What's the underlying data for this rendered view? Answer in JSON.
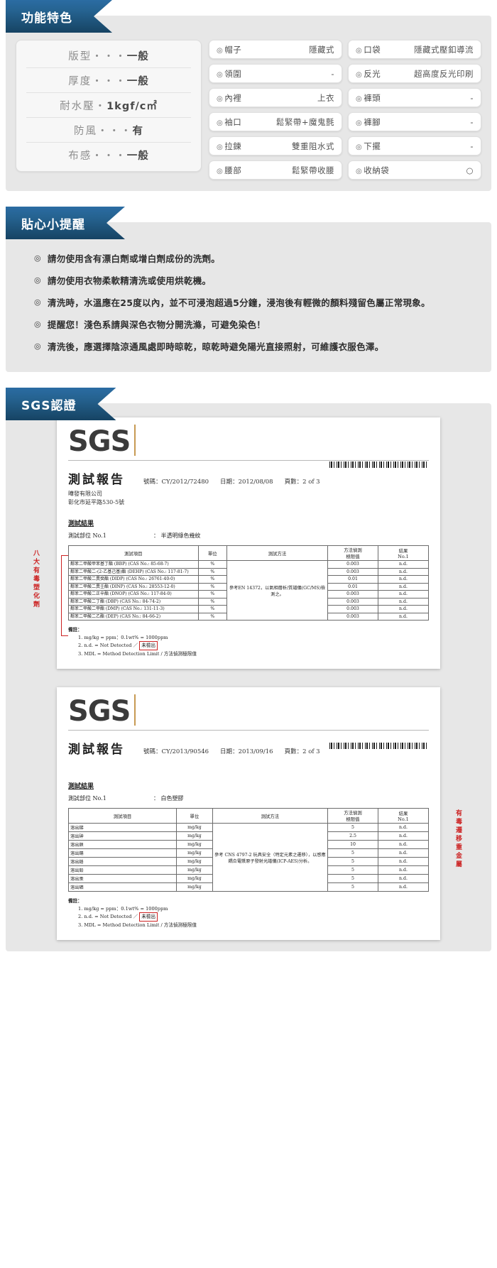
{
  "sections": {
    "features": {
      "title": "功能特色"
    },
    "tips": {
      "title": "貼心小提醒"
    },
    "sgs": {
      "title": "SGS認證"
    }
  },
  "spec_list": [
    {
      "key": "版型",
      "dots": "・・・",
      "value": "一般"
    },
    {
      "key": "厚度",
      "dots": "・・・",
      "value": "一般"
    },
    {
      "key": "耐水壓",
      "dots": "・",
      "value": "1kgf/c㎡"
    },
    {
      "key": "防風",
      "dots": "・・・",
      "value": "有"
    },
    {
      "key": "布感",
      "dots": "・・・",
      "value": "一般"
    }
  ],
  "feature_items_left": [
    {
      "icon": "circle-dot-icon",
      "label": "帽子",
      "value": "隱藏式"
    },
    {
      "icon": "circle-dot-icon",
      "label": "領圍",
      "value": "-"
    },
    {
      "icon": "circle-dot-icon",
      "label": "內裡",
      "value": "上衣"
    },
    {
      "icon": "circle-dot-icon",
      "label": "袖口",
      "value": "鬆緊帶+魔鬼氈"
    },
    {
      "icon": "circle-dot-icon",
      "label": "拉鍊",
      "value": "雙重阻水式"
    },
    {
      "icon": "circle-dot-icon",
      "label": "腰部",
      "value": "鬆緊帶收腰"
    }
  ],
  "feature_items_right": [
    {
      "icon": "circle-dot-icon",
      "label": "口袋",
      "value": "隱藏式壓釦導流"
    },
    {
      "icon": "circle-dot-icon",
      "label": "反光",
      "value": "超高度反光印刷"
    },
    {
      "icon": "circle-dot-icon",
      "label": "褲頭",
      "value": "-"
    },
    {
      "icon": "circle-dot-icon",
      "label": "褲腳",
      "value": "-"
    },
    {
      "icon": "circle-dot-icon",
      "label": "下擺",
      "value": "-"
    },
    {
      "icon": "circle-dot-icon",
      "label": "收納袋",
      "value": "○"
    }
  ],
  "tips": [
    {
      "bullet": "◎",
      "text": "請勿使用含有漂白劑或增白劑成份的洗劑。"
    },
    {
      "bullet": "◎",
      "text": "請勿使用衣物柔軟精清洗或使用烘乾機。"
    },
    {
      "bullet": "◎",
      "text": "清洗時，水溫應在25度以內，並不可浸泡超過5分鐘，浸泡後有輕微的顏料殘留色屬正常現象。"
    },
    {
      "bullet": "◎",
      "text": "提醒您！淺色系請與深色衣物分開洗滌，可避免染色！"
    },
    {
      "bullet": "◎",
      "text": "清洗後，應選擇陰涼通風處即時晾乾，晾乾時避免陽光直接照射，可維護衣服色澤。"
    }
  ],
  "reports": [
    {
      "logo": "SGS",
      "title": "測試報告",
      "meta": [
        {
          "label": "號碼",
          "sep": "：",
          "value": "CY/2012/72480"
        },
        {
          "label": "日期",
          "sep": "：",
          "value": "2012/08/08"
        },
        {
          "label": "頁數",
          "sep": "：",
          "value": "2 of 3"
        }
      ],
      "company": [
        "曄發有限公司",
        "彰化市延平路530-5號"
      ],
      "result_heading": "測試結果",
      "part_label": "測試部位 No.1",
      "part_sep": "：",
      "part_value": "半透明綠色幾紋",
      "side_label": "八大有毒塑化劑",
      "side_position": "left",
      "columns": [
        "測試項目",
        "單位",
        "測試方法",
        "方法偵測極限值",
        "結果 No.1"
      ],
      "col_head_2line": {
        "c4a": "方法偵測",
        "c4b": "極限值",
        "c5a": "結果",
        "c5b": "No.1"
      },
      "method_text": "參考EN 14372，以氣相層析/質譜儀(GC/MS)檢測之。",
      "rows": [
        {
          "item": "鄰苯二甲酸甲苯基丁酯 (BBP) (CAS No.: 85-68-7)",
          "unit": "%",
          "limit": "0.003",
          "result": "n.d."
        },
        {
          "item": "鄰苯二甲酸二-(2-乙基己基)酯 (DEHP) (CAS No.: 117-81-7)",
          "unit": "%",
          "limit": "0.003",
          "result": "n.d."
        },
        {
          "item": "鄰苯二甲酸二異癸酯 (DIDP) (CAS No.: 26761-40-0)",
          "unit": "%",
          "limit": "0.01",
          "result": "n.d."
        },
        {
          "item": "鄰苯二甲酸二異壬酯 (DINP) (CAS No.: 28553-12-0)",
          "unit": "%",
          "limit": "0.01",
          "result": "n.d."
        },
        {
          "item": "鄰苯二甲酸二正辛酯 (DNOP) (CAS No.: 117-84-0)",
          "unit": "%",
          "limit": "0.003",
          "result": "n.d."
        },
        {
          "item": "鄰苯二甲酸二丁酯 (DBP) (CAS No.: 84-74-2)",
          "unit": "%",
          "limit": "0.003",
          "result": "n.d."
        },
        {
          "item": "鄰苯二甲酸二甲酯 (DMP) (CAS No.: 131-11-3)",
          "unit": "%",
          "limit": "0.003",
          "result": "n.d."
        },
        {
          "item": "鄰苯二甲酸二乙酯 (DEP) (CAS No.: 84-66-2)",
          "unit": "%",
          "limit": "0.003",
          "result": "n.d."
        }
      ],
      "notes_heading": "備註：",
      "notes": [
        {
          "text": "1. mg/kg = ppm：0.1wt% = 1000ppm",
          "boxed": ""
        },
        {
          "text": "2. n.d. = Not Detected ／",
          "boxed": "未檢出"
        },
        {
          "text": "3. MDL = Method Detection Limit / 方法偵測極限值",
          "boxed": ""
        }
      ]
    },
    {
      "logo": "SGS",
      "title": "測試報告",
      "meta": [
        {
          "label": "號碼",
          "sep": "：",
          "value": "CY/2013/90546"
        },
        {
          "label": "日期",
          "sep": "：",
          "value": "2013/09/16"
        },
        {
          "label": "頁數",
          "sep": "：",
          "value": "2 of 3"
        }
      ],
      "company": [],
      "result_heading": "測試結果",
      "part_label": "測試部位 No.1",
      "part_sep": "：",
      "part_value": "白色塑膠",
      "side_label": "有毒遷移重金屬",
      "side_position": "right",
      "columns": [
        "測試項目",
        "單位",
        "測試方法",
        "方法偵測極限值",
        "結果 No.1"
      ],
      "col_head_2line": {
        "c4a": "方法偵測",
        "c4b": "極限值",
        "c5a": "結果",
        "c5b": "No.1"
      },
      "method_text": "參考 CNS 4797-2 玩具安全（特定元素之遷移），以感應耦合電漿原子發射光譜儀(ICP-AES)分析。",
      "rows": [
        {
          "item": "溶出銻",
          "unit": "mg/kg",
          "limit": "5",
          "result": "n.d."
        },
        {
          "item": "溶出砷",
          "unit": "mg/kg",
          "limit": "2.5",
          "result": "n.d."
        },
        {
          "item": "溶出鋇",
          "unit": "mg/kg",
          "limit": "10",
          "result": "n.d."
        },
        {
          "item": "溶出鎘",
          "unit": "mg/kg",
          "limit": "5",
          "result": "n.d."
        },
        {
          "item": "溶出鉻",
          "unit": "mg/kg",
          "limit": "5",
          "result": "n.d."
        },
        {
          "item": "溶出鉛",
          "unit": "mg/kg",
          "limit": "5",
          "result": "n.d."
        },
        {
          "item": "溶出汞",
          "unit": "mg/kg",
          "limit": "5",
          "result": "n.d."
        },
        {
          "item": "溶出硒",
          "unit": "mg/kg",
          "limit": "5",
          "result": "n.d."
        }
      ],
      "notes_heading": "備註：",
      "notes": [
        {
          "text": "1. mg/kg = ppm：0.1wt% = 1000ppm",
          "boxed": ""
        },
        {
          "text": "2. n.d. = Not Detected ／",
          "boxed": "未檢出"
        },
        {
          "text": "3. MDL = Method Detection Limit / 方法偵測極限值",
          "boxed": ""
        }
      ]
    }
  ],
  "colors": {
    "ribbon_dark": "#164363",
    "ribbon_light": "#2b6ca3",
    "panel": "#e7e7e7",
    "red": "#cc2222"
  }
}
